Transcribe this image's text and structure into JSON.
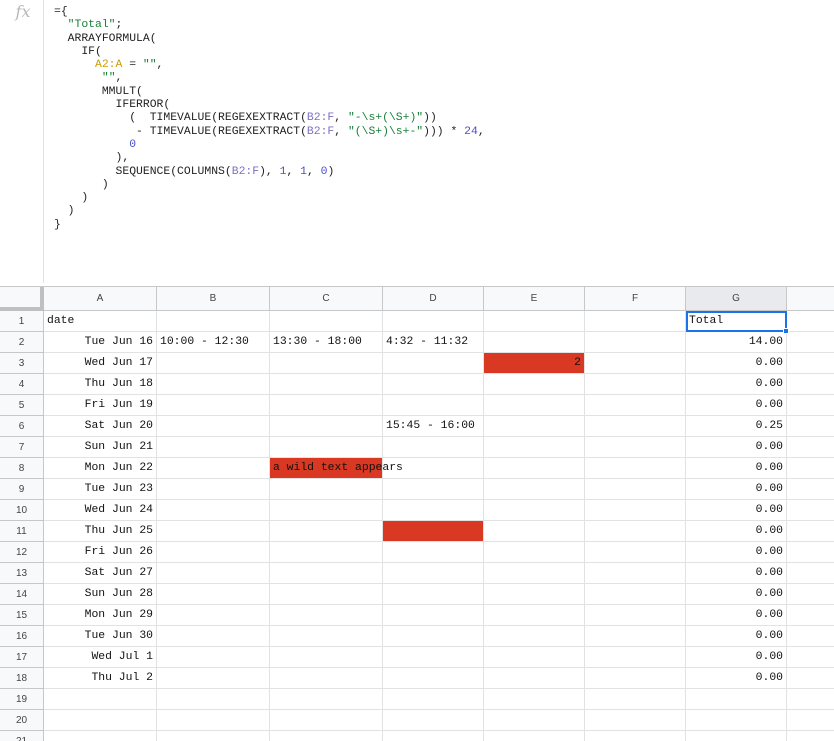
{
  "formula_bar": {
    "fx_label": "fx",
    "lines": [
      [
        {
          "t": "={",
          "c": ""
        }
      ],
      [
        {
          "t": "  ",
          "c": ""
        },
        {
          "t": "\"Total\"",
          "c": "str"
        },
        {
          "t": ";",
          "c": ""
        }
      ],
      [
        {
          "t": "  ARRAYFORMULA(",
          "c": ""
        }
      ],
      [
        {
          "t": "    IF(",
          "c": ""
        }
      ],
      [
        {
          "t": "      ",
          "c": ""
        },
        {
          "t": "A2:A",
          "c": "range-a"
        },
        {
          "t": " = ",
          "c": ""
        },
        {
          "t": "\"\"",
          "c": "str"
        },
        {
          "t": ",",
          "c": ""
        }
      ],
      [
        {
          "t": "       ",
          "c": ""
        },
        {
          "t": "\"\"",
          "c": "str"
        },
        {
          "t": ",",
          "c": ""
        }
      ],
      [
        {
          "t": "       MMULT(",
          "c": ""
        }
      ],
      [
        {
          "t": "         IFERROR(",
          "c": ""
        }
      ],
      [
        {
          "t": "           (  TIMEVALUE(REGEXEXTRACT(",
          "c": ""
        },
        {
          "t": "B2:F",
          "c": "range-b"
        },
        {
          "t": ", ",
          "c": ""
        },
        {
          "t": "\"-\\s+(\\S+)\"",
          "c": "str"
        },
        {
          "t": "))",
          "c": ""
        }
      ],
      [
        {
          "t": "            - TIMEVALUE(REGEXEXTRACT(",
          "c": ""
        },
        {
          "t": "B2:F",
          "c": "range-b"
        },
        {
          "t": ", ",
          "c": ""
        },
        {
          "t": "\"(\\S+)\\s+-\"",
          "c": "str"
        },
        {
          "t": "))) * ",
          "c": ""
        },
        {
          "t": "24",
          "c": "num"
        },
        {
          "t": ",",
          "c": ""
        }
      ],
      [
        {
          "t": "           ",
          "c": ""
        },
        {
          "t": "0",
          "c": "num"
        }
      ],
      [
        {
          "t": "         ),",
          "c": ""
        }
      ],
      [
        {
          "t": "         SEQUENCE(COLUMNS(",
          "c": ""
        },
        {
          "t": "B2:F",
          "c": "range-b"
        },
        {
          "t": "), ",
          "c": ""
        },
        {
          "t": "1",
          "c": "num"
        },
        {
          "t": ", ",
          "c": ""
        },
        {
          "t": "1",
          "c": "num"
        },
        {
          "t": ", ",
          "c": ""
        },
        {
          "t": "0",
          "c": "num"
        },
        {
          "t": ")",
          "c": ""
        }
      ],
      [
        {
          "t": "       )",
          "c": ""
        }
      ],
      [
        {
          "t": "    )",
          "c": ""
        }
      ],
      [
        {
          "t": "  )",
          "c": ""
        }
      ],
      [
        {
          "t": "}",
          "c": ""
        }
      ]
    ]
  },
  "columns": [
    "A",
    "B",
    "C",
    "D",
    "E",
    "F",
    "G"
  ],
  "active_column": "G",
  "rows": [
    {
      "num": "1",
      "A": "date",
      "B": "",
      "C": "",
      "D": "",
      "E": "",
      "G": "Total"
    },
    {
      "num": "2",
      "A": "Tue Jun 16",
      "B": "10:00 - 12:30",
      "C": "13:30 - 18:00",
      "D": "4:32 - 11:32",
      "E": "",
      "G": "14.00"
    },
    {
      "num": "3",
      "A": "Wed Jun 17",
      "B": "",
      "C": "",
      "D": "",
      "E": "2",
      "G": "0.00"
    },
    {
      "num": "4",
      "A": "Thu Jun 18",
      "B": "",
      "C": "",
      "D": "",
      "E": "",
      "G": "0.00"
    },
    {
      "num": "5",
      "A": "Fri Jun 19",
      "B": "",
      "C": "",
      "D": "",
      "E": "",
      "G": "0.00"
    },
    {
      "num": "6",
      "A": "Sat Jun 20",
      "B": "",
      "C": "",
      "D": "15:45 - 16:00",
      "E": "",
      "G": "0.25"
    },
    {
      "num": "7",
      "A": "Sun Jun 21",
      "B": "",
      "C": "",
      "D": "",
      "E": "",
      "G": "0.00"
    },
    {
      "num": "8",
      "A": "Mon Jun 22",
      "B": "",
      "C": "a wild text appears",
      "D": "",
      "E": "",
      "G": "0.00"
    },
    {
      "num": "9",
      "A": "Tue Jun 23",
      "B": "",
      "C": "",
      "D": "",
      "E": "",
      "G": "0.00"
    },
    {
      "num": "10",
      "A": "Wed Jun 24",
      "B": "",
      "C": "",
      "D": "",
      "E": "",
      "G": "0.00"
    },
    {
      "num": "11",
      "A": "Thu Jun 25",
      "B": "",
      "C": "",
      "D": "",
      "E": "",
      "G": "0.00"
    },
    {
      "num": "12",
      "A": "Fri Jun 26",
      "B": "",
      "C": "",
      "D": "",
      "E": "",
      "G": "0.00"
    },
    {
      "num": "13",
      "A": "Sat Jun 27",
      "B": "",
      "C": "",
      "D": "",
      "E": "",
      "G": "0.00"
    },
    {
      "num": "14",
      "A": "Sun Jun 28",
      "B": "",
      "C": "",
      "D": "",
      "E": "",
      "G": "0.00"
    },
    {
      "num": "15",
      "A": "Mon Jun 29",
      "B": "",
      "C": "",
      "D": "",
      "E": "",
      "G": "0.00"
    },
    {
      "num": "16",
      "A": "Tue Jun 30",
      "B": "",
      "C": "",
      "D": "",
      "E": "",
      "G": "0.00"
    },
    {
      "num": "17",
      "A": "Wed Jul 1",
      "B": "",
      "C": "",
      "D": "",
      "E": "",
      "G": "0.00"
    },
    {
      "num": "18",
      "A": "Thu Jul 2",
      "B": "",
      "C": "",
      "D": "",
      "E": "",
      "G": "0.00"
    },
    {
      "num": "19",
      "A": "",
      "B": "",
      "C": "",
      "D": "",
      "E": "",
      "G": ""
    },
    {
      "num": "20",
      "A": "",
      "B": "",
      "C": "",
      "D": "",
      "E": "",
      "G": ""
    },
    {
      "num": "21",
      "A": "",
      "B": "",
      "C": "",
      "D": "",
      "E": "",
      "G": ""
    }
  ],
  "highlighted_cells": [
    "E3",
    "C8",
    "D11"
  ],
  "highlight_color": "#d93822",
  "selected_cell": "G1",
  "selection_color": "#1a73e8"
}
